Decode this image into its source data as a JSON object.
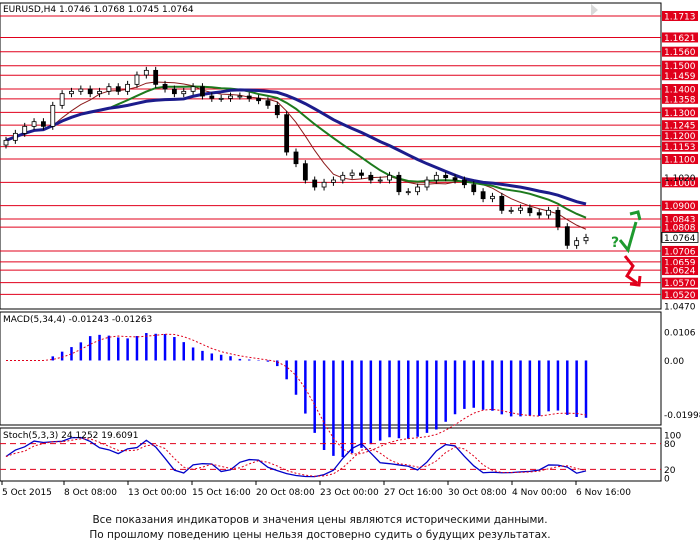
{
  "chart_data": [
    {
      "type": "candlestick",
      "symbol_label": "EURUSD,H4",
      "ohlc": [
        1.0746,
        1.0768,
        1.0745,
        1.0764
      ],
      "current_price": "1.0764",
      "price_axis_labels": [
        "1.1713",
        "1.1621",
        "1.1560",
        "1.1500",
        "1.1459",
        "1.1400",
        "1.1358",
        "1.1300",
        "1.1245",
        "1.1200",
        "1.1153",
        "1.1100",
        "1.1000",
        "1.0900",
        "1.0843",
        "1.0808",
        "1.0764",
        "1.0706",
        "1.0659",
        "1.0624",
        "1.0570",
        "1.0520",
        "1.0470"
      ],
      "red_levels": [
        1.1713,
        1.1621,
        1.156,
        1.15,
        1.1459,
        1.14,
        1.1358,
        1.13,
        1.1245,
        1.12,
        1.1153,
        1.11,
        1.1,
        1.09,
        1.0843,
        1.0808,
        1.0706,
        1.0659,
        1.0624,
        1.057,
        1.052
      ],
      "extra_axis_labels": [
        "1.1020"
      ],
      "ylim": [
        1.046,
        1.172
      ],
      "candles_approx_close": [
        1.118,
        1.121,
        1.124,
        1.126,
        1.124,
        1.133,
        1.138,
        1.139,
        1.14,
        1.138,
        1.139,
        1.141,
        1.139,
        1.142,
        1.146,
        1.148,
        1.142,
        1.14,
        1.138,
        1.139,
        1.141,
        1.137,
        1.136,
        1.136,
        1.137,
        1.137,
        1.136,
        1.135,
        1.133,
        1.129,
        1.113,
        1.108,
        1.101,
        1.098,
        1.1,
        1.101,
        1.103,
        1.104,
        1.103,
        1.101,
        1.101,
        1.103,
        1.096,
        1.096,
        1.098,
        1.101,
        1.103,
        1.102,
        1.101,
        1.099,
        1.096,
        1.093,
        1.094,
        1.088,
        1.088,
        1.089,
        1.087,
        1.086,
        1.088,
        1.081,
        1.073,
        1.075,
        1.0764
      ],
      "ma_fast_end": 1.091,
      "ma_mid_end": 1.097,
      "ma_slow_end": 1.103
    },
    {
      "type": "bar",
      "indicator_label": "MACD(5,34,4) -0.01243 -0.01263",
      "axis_labels": [
        "0.0106",
        "0.00",
        "-0.01998"
      ],
      "ylim": [
        -0.022,
        0.012
      ]
    },
    {
      "type": "line",
      "indicator_label": "Stoch(5,3,3) 24.1252 19.6091",
      "axis_labels": [
        "100",
        "80",
        "20",
        "0"
      ],
      "ylim": [
        0,
        100
      ]
    }
  ],
  "x_axis_labels": [
    "5 Oct 2015",
    "8 Oct 08:00",
    "13 Oct 00:00",
    "15 Oct 16:00",
    "20 Oct 08:00",
    "23 Oct 00:00",
    "27 Oct 16:00",
    "30 Oct 08:00",
    "4 Nov 00:00",
    "6 Nov 16:00"
  ],
  "annotation": "?",
  "disclaimer_line1": "Все показания индикаторов и значения цены являются историческими данными.",
  "disclaimer_line2": "По прошлому поведению цены нельзя достоверно судить о будущих результатах.",
  "colors": {
    "level": "#e0001b",
    "ma_slow": "#1c1c8c",
    "ma_mid": "#1d7a1d",
    "ma_fast": "#8b1a1a",
    "macd": "#0000ff",
    "signal": "#e0001b",
    "stoch_main": "#0000c8",
    "stoch_signal": "#e0001b",
    "arrow_up": "#1e9a2e",
    "arrow_down": "#e0001b"
  }
}
